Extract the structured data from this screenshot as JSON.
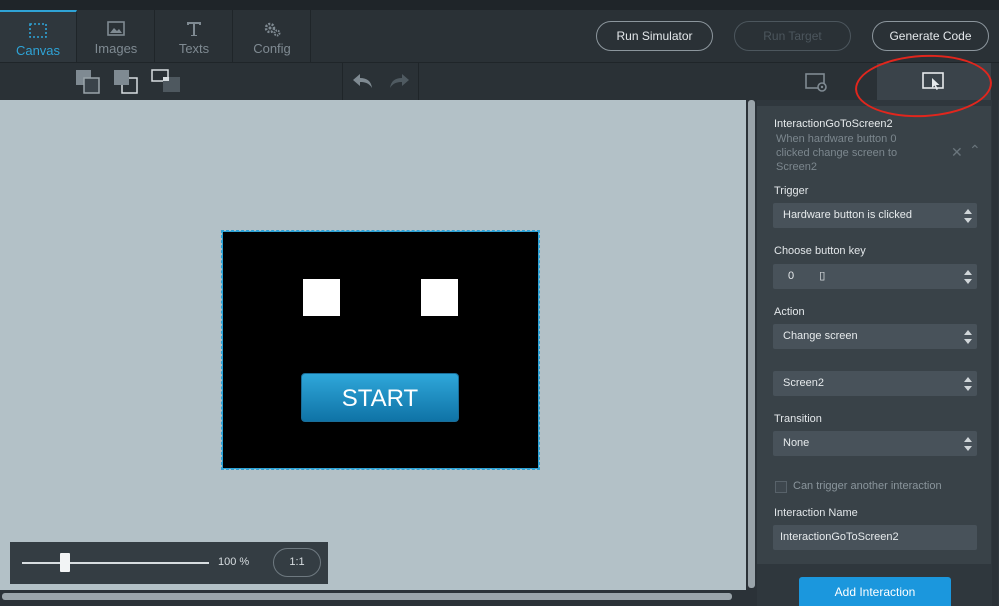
{
  "tabs": [
    {
      "label": "Canvas",
      "icon": "canvas-select-icon"
    },
    {
      "label": "Images",
      "icon": "image-icon"
    },
    {
      "label": "Texts",
      "icon": "text-icon"
    },
    {
      "label": "Config",
      "icon": "gears-icon"
    }
  ],
  "header": {
    "run_simulator": "Run Simulator",
    "run_target": "Run Target",
    "generate_code": "Generate Code"
  },
  "canvas": {
    "start_label": "START",
    "zoom_value": "100 %",
    "ratio_label": "1:1"
  },
  "panel": {
    "interaction_title": "InteractionGoToScreen2",
    "interaction_desc": "When hardware button 0 clicked change screen to Screen2",
    "trigger_label": "Trigger",
    "trigger_value": "Hardware button is clicked",
    "button_key_label": "Choose button key",
    "button_key_value": "0",
    "button_key_glyph": "▯",
    "action_label": "Action",
    "action_value": "Change screen",
    "screen_value": "Screen2",
    "transition_label": "Transition",
    "transition_value": "None",
    "can_trigger_label": "Can trigger another interaction",
    "name_label": "Interaction Name",
    "name_value": "InteractionGoToScreen2",
    "add_interaction": "Add Interaction",
    "close_glyph": "✕",
    "collapse_glyph": "⌃"
  },
  "colors": {
    "accent": "#2fa3d6",
    "add_button": "#1b97dd",
    "annotation": "#e1261d"
  }
}
